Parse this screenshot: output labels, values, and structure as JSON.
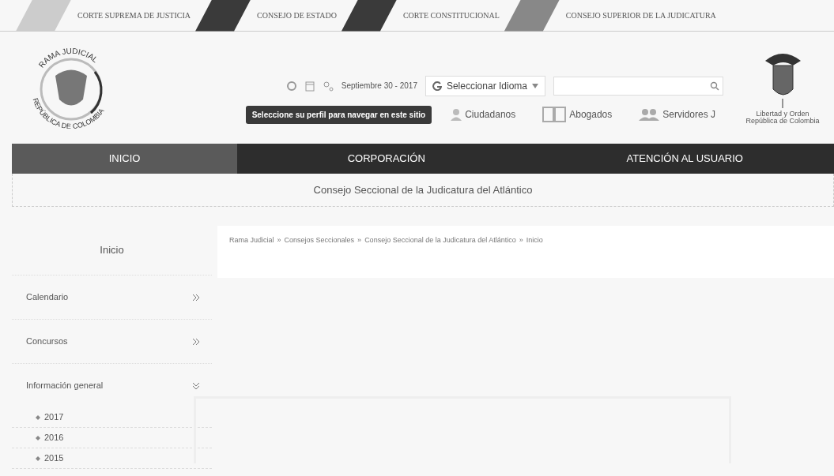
{
  "top_links": [
    "CORTE SUPREMA DE JUSTICIA",
    "CONSEJO DE ESTADO",
    "CORTE CONSTITUCIONAL",
    "CONSEJO SUPERIOR DE LA JUDICATURA"
  ],
  "logo_left": {
    "top_text": "RAMA JUDICIAL",
    "bottom_text": "REPÚBLICA DE COLOMBIA"
  },
  "toolbar": {
    "date": "Septiembre 30 - 2017",
    "language": "Seleccionar Idioma"
  },
  "profile_prompt": "Seleccione su perfil para navegar en este sitio",
  "profiles": [
    {
      "label": "Ciudadanos",
      "kind": "person"
    },
    {
      "label": "Abogados",
      "kind": "book"
    },
    {
      "label": "Servidores J",
      "kind": "group"
    }
  ],
  "logo_right": {
    "motto": "Libertad y Orden",
    "country": "República de Colombia"
  },
  "nav": [
    {
      "label": "INICIO",
      "selected": true
    },
    {
      "label": "CORPORACIÓN",
      "selected": false
    },
    {
      "label": "ATENCIÓN AL USUARIO",
      "selected": false
    }
  ],
  "subtitle": "Consejo Seccional de la Judicatura del Atlántico",
  "sidebar": {
    "title": "Inicio",
    "items": [
      {
        "label": "Calendario",
        "expanded": false
      },
      {
        "label": "Concursos",
        "expanded": false
      },
      {
        "label": "Información general",
        "expanded": true,
        "children": [
          {
            "label": "2017"
          },
          {
            "label": "2016"
          },
          {
            "label": "2015"
          }
        ]
      }
    ]
  },
  "breadcrumb": {
    "separator": "»",
    "items": [
      "Rama Judicial",
      "Consejos Seccionales",
      "Consejo Seccional de la Judicatura del Atlántico",
      "Inicio"
    ]
  }
}
